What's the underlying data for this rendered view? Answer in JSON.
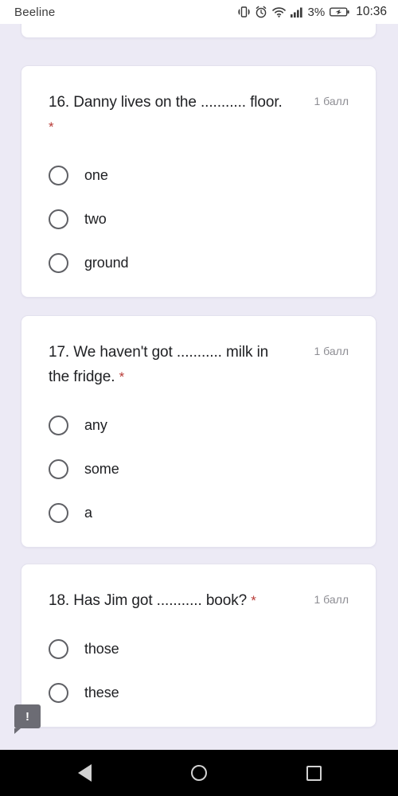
{
  "statusbar": {
    "carrier": "Beeline",
    "battery_percent": "3%",
    "time": "10:36",
    "icons": [
      "vibrate-icon",
      "alarm-icon",
      "wifi-icon",
      "signal-icon",
      "battery-charging-icon"
    ]
  },
  "questions": [
    {
      "text": "16. Danny lives on the ........... floor.",
      "required_marker": "*",
      "points": "1 балл",
      "options": [
        "one",
        "two",
        "ground"
      ]
    },
    {
      "text": "17. We haven't got ........... milk in the fridge.",
      "required_marker": "*",
      "points": "1 балл",
      "options": [
        "any",
        "some",
        "a"
      ]
    },
    {
      "text": "18. Has Jim got ........... book?",
      "required_marker": "*",
      "points": "1 балл",
      "options": [
        "those",
        "these"
      ]
    }
  ],
  "feedback_button": {
    "label": "!"
  },
  "navbar": {
    "back": "back-button",
    "home": "home-button",
    "recents": "recents-button"
  },
  "colors": {
    "background": "#eceaf5",
    "card": "#ffffff",
    "required_star": "#b83b37",
    "points_text": "#8d8d93",
    "primary_text": "#202124"
  }
}
